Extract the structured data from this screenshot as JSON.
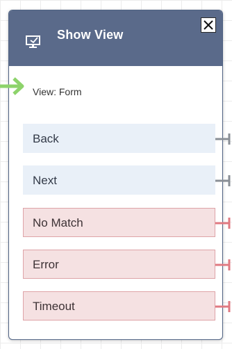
{
  "block": {
    "title": "Show View",
    "icon": "monitor-icon",
    "close_icon": "close-icon",
    "parameter_label": "View: Form"
  },
  "branches": [
    {
      "label": "Back",
      "status": "success"
    },
    {
      "label": "Next",
      "status": "success"
    },
    {
      "label": "No Match",
      "status": "error"
    },
    {
      "label": "Error",
      "status": "error"
    },
    {
      "label": "Timeout",
      "status": "error"
    }
  ],
  "colors": {
    "header": "#5a6a8a",
    "success_branch": "#e9f0f8",
    "error_branch": "#f5e1e2",
    "success_connector": "#8a8f96",
    "error_connector": "#e07a82",
    "entry_arrow": "#8dd36b"
  }
}
